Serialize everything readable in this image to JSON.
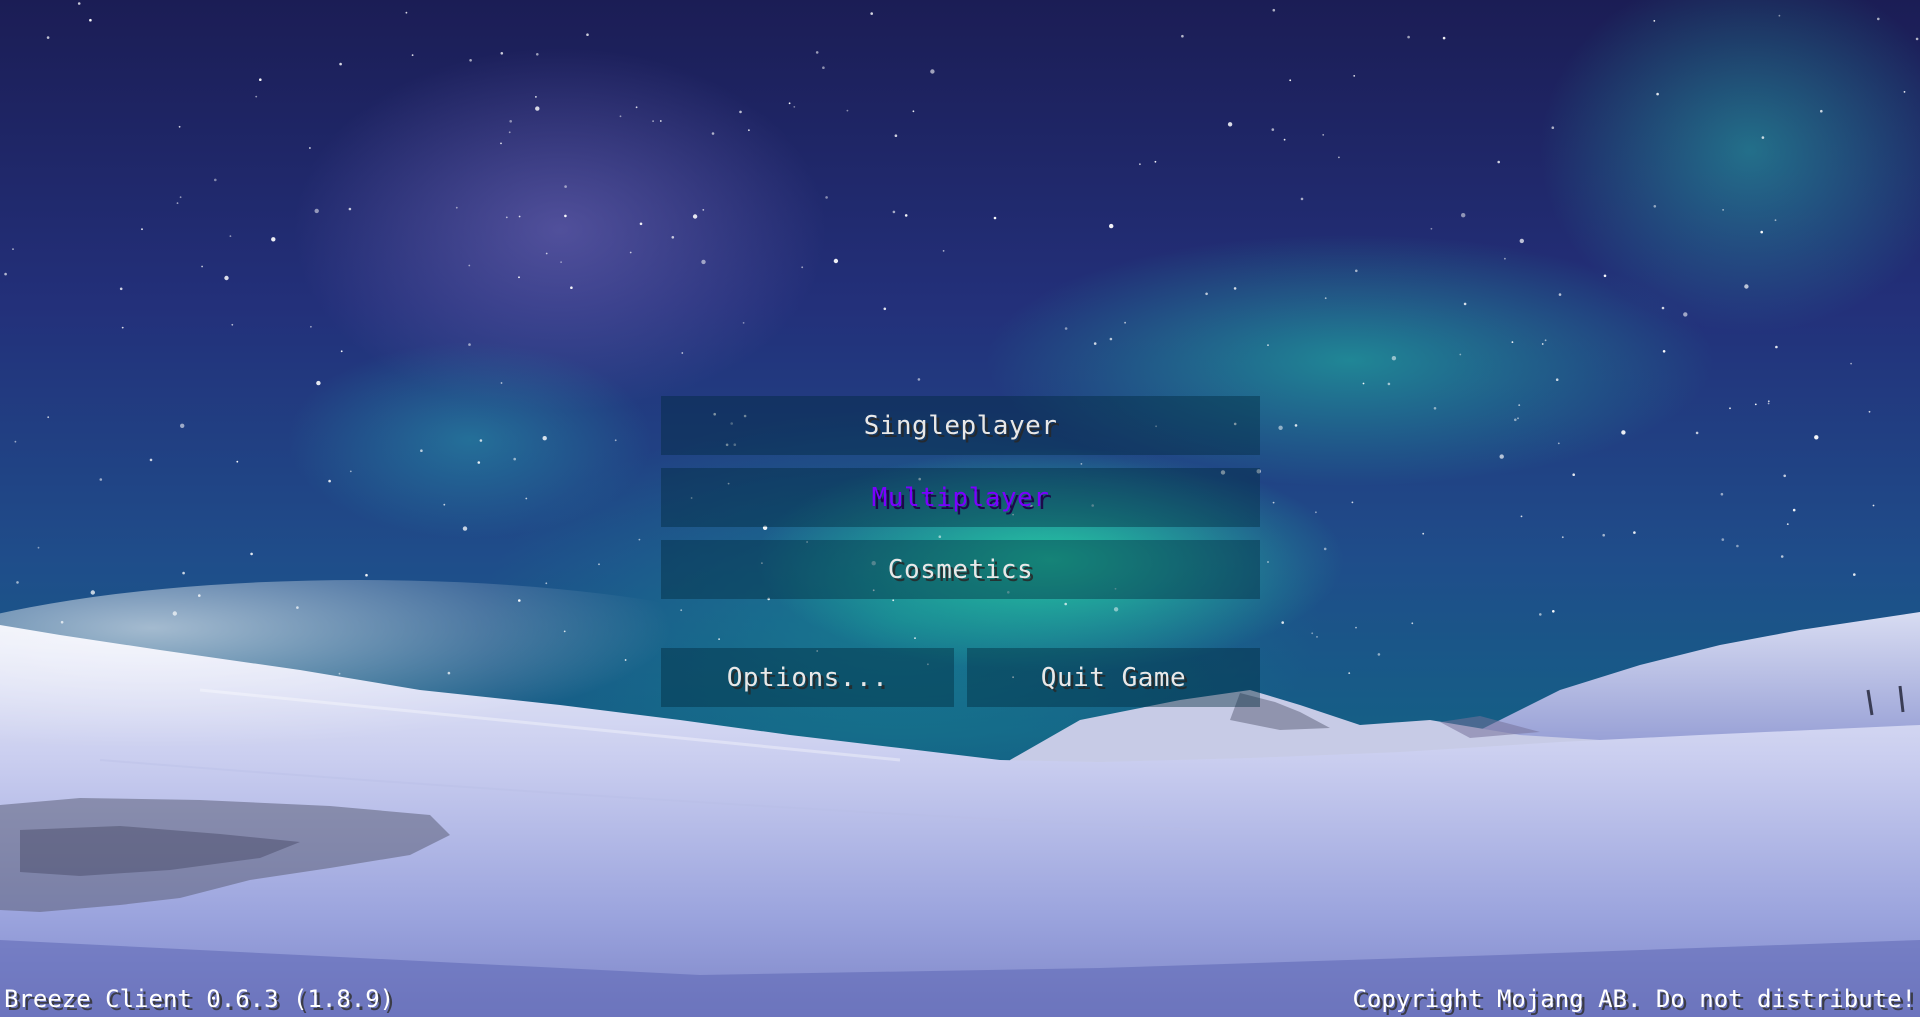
{
  "menu": {
    "singleplayer_label": "Singleplayer",
    "multiplayer_label": "Multiplayer",
    "cosmetics_label": "Cosmetics",
    "options_label": "Options...",
    "quit_label": "Quit Game"
  },
  "footer": {
    "version": "Breeze Client 0.6.3 (1.8.9)",
    "copyright": "Copyright Mojang AB. Do not distribute!"
  },
  "colors": {
    "button_text": "#e8e8e8",
    "button_hover_text": "#7a00ff",
    "button_background": "rgba(0,40,60,0.42)"
  }
}
